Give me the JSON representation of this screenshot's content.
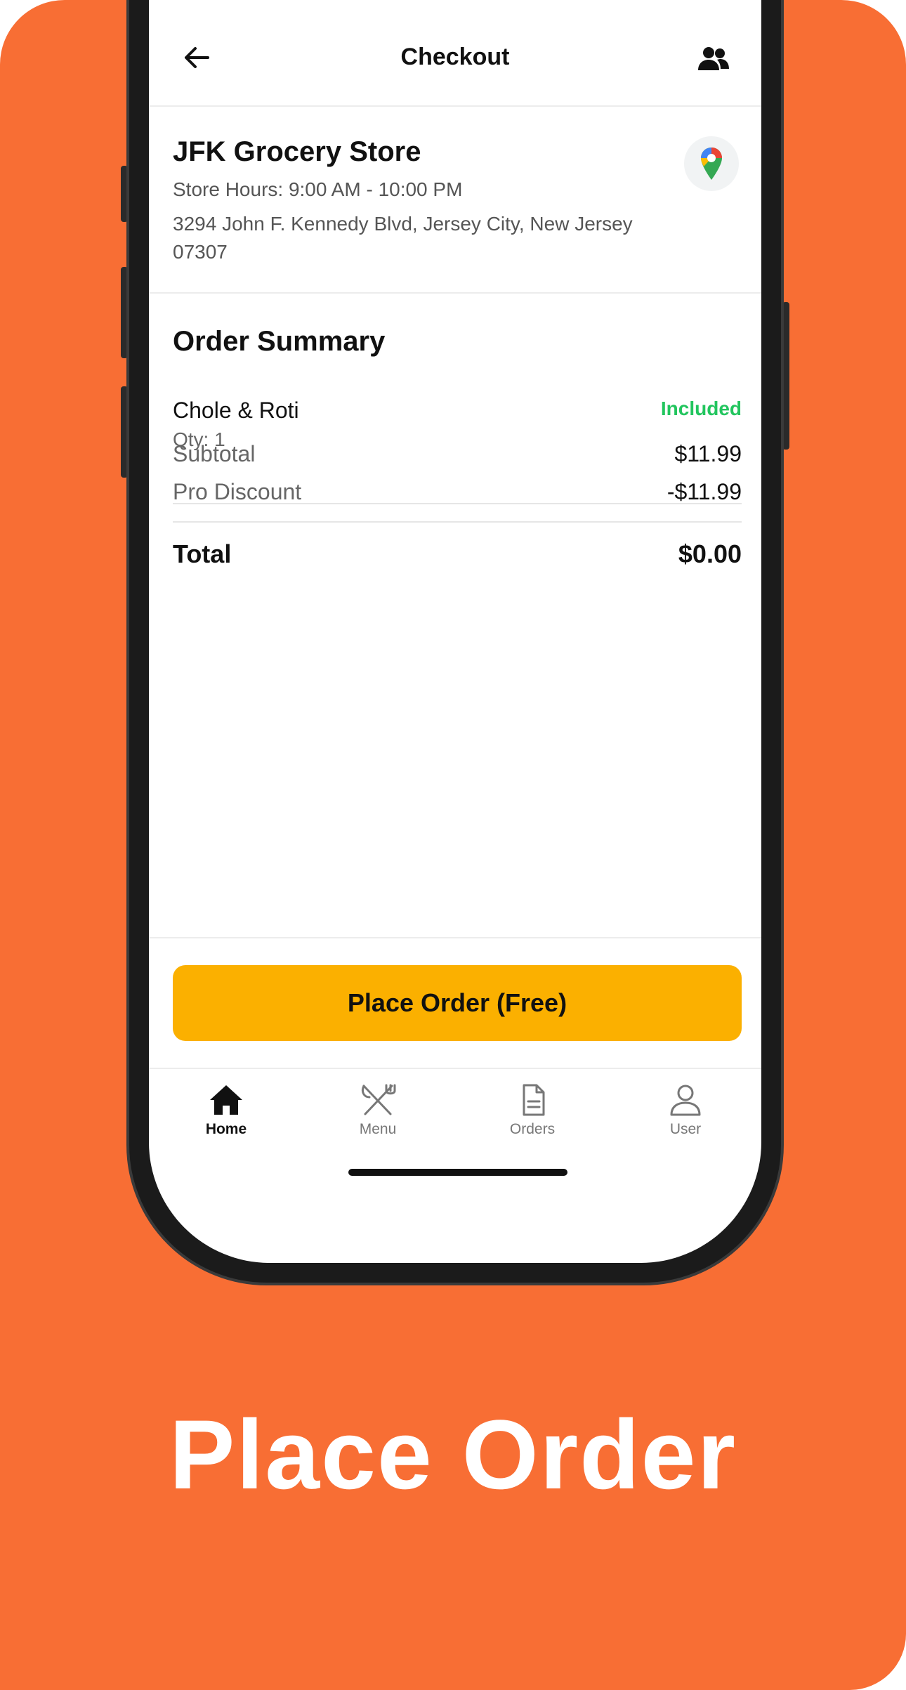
{
  "colors": {
    "background": "#f86e34",
    "accent_button": "#fbb000",
    "included_green": "#22c55e",
    "caption_text": "#ffffff"
  },
  "header": {
    "title": "Checkout",
    "back_icon": "arrow-left-icon",
    "right_icon": "people-icon"
  },
  "store": {
    "name": "JFK Grocery Store",
    "hours": "Store Hours: 9:00 AM - 10:00 PM",
    "address": "3294 John F. Kennedy Blvd, Jersey City, New Jersey 07307",
    "map_icon": "map-pin-icon"
  },
  "order_summary": {
    "title": "Order Summary",
    "items": [
      {
        "name": "Chole & Roti",
        "qty": "Qty: 1",
        "status": "Included"
      }
    ],
    "subtotal_label": "Subtotal",
    "subtotal_value": "$11.99",
    "discount_label": "Pro Discount",
    "discount_value": "-$11.99",
    "total_label": "Total",
    "total_value": "$0.00"
  },
  "place_order_label": "Place Order (Free)",
  "bottom_nav": [
    {
      "label": "Home",
      "icon": "home-icon",
      "active": true
    },
    {
      "label": "Menu",
      "icon": "utensils-icon",
      "active": false
    },
    {
      "label": "Orders",
      "icon": "document-icon",
      "active": false
    },
    {
      "label": "User",
      "icon": "user-icon",
      "active": false
    }
  ],
  "caption": "Place Order"
}
